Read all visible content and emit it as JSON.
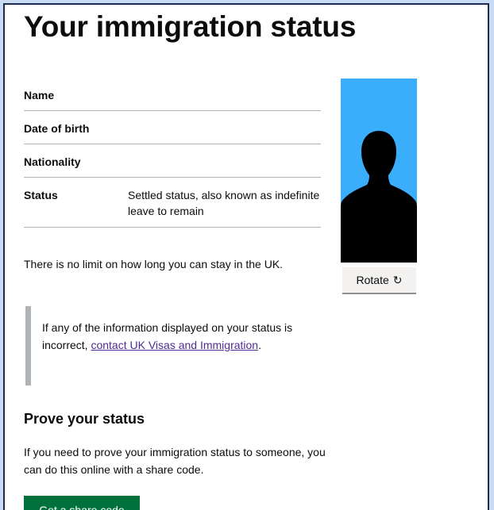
{
  "page": {
    "title": "Your immigration status"
  },
  "summary": {
    "rows": [
      {
        "key": "Name",
        "value": ""
      },
      {
        "key": "Date of birth",
        "value": ""
      },
      {
        "key": "Nationality",
        "value": ""
      },
      {
        "key": "Status",
        "value": "Settled status, also known as indefinite leave to remain"
      }
    ]
  },
  "photo": {
    "icon": "person-silhouette-icon",
    "background_color": "#3aaefb",
    "rotate_label": "Rotate",
    "rotate_icon": "rotate-icon",
    "rotate_glyph": "↻"
  },
  "limit_text": "There is no limit on how long you can stay in the UK.",
  "inset": {
    "text_before": "If any of the information displayed on your status is incorrect, ",
    "link_text": "contact UK Visas and Immigration",
    "text_after": "."
  },
  "prove": {
    "heading": "Prove your status",
    "text": "If you need to prove your immigration status to someone, you can do this online with a share code.",
    "button_label": "Get a share code"
  },
  "colors": {
    "text": "#0b0c0c",
    "link": "#4c2c92",
    "button_green": "#00703c",
    "border_grey": "#b1b4b6",
    "outer_background": "#c9daf4",
    "frame_border": "#1d2b50"
  }
}
